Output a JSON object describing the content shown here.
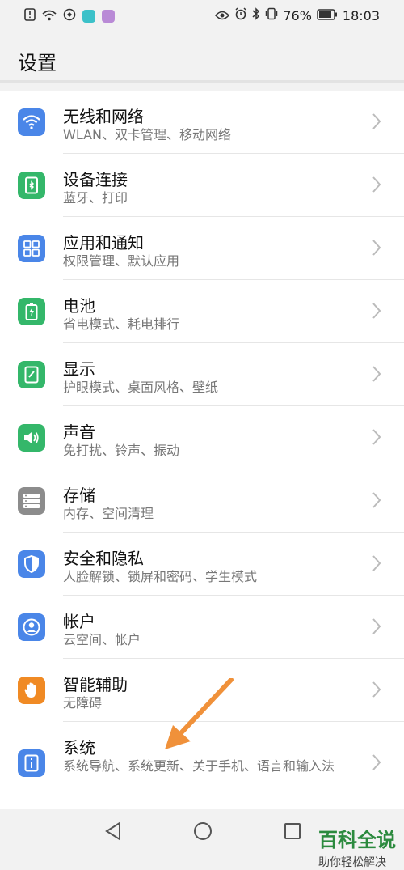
{
  "status": {
    "battery": "76%",
    "time": "18:03"
  },
  "page": {
    "title": "设置"
  },
  "items": [
    {
      "label": "无线和网络",
      "sub": "WLAN、双卡管理、移动网络",
      "icon": "wifi-icon",
      "color": "#4a86e8"
    },
    {
      "label": "设备连接",
      "sub": "蓝牙、打印",
      "icon": "device-connection-icon",
      "color": "#34b76a"
    },
    {
      "label": "应用和通知",
      "sub": "权限管理、默认应用",
      "icon": "apps-grid-icon",
      "color": "#4a86e8"
    },
    {
      "label": "电池",
      "sub": "省电模式、耗电排行",
      "icon": "battery-icon",
      "color": "#34b76a"
    },
    {
      "label": "显示",
      "sub": "护眼模式、桌面风格、壁纸",
      "icon": "display-icon",
      "color": "#34b76a"
    },
    {
      "label": "声音",
      "sub": "免打扰、铃声、振动",
      "icon": "speaker-icon",
      "color": "#34b76a"
    },
    {
      "label": "存储",
      "sub": "内存、空间清理",
      "icon": "storage-icon",
      "color": "#8c8c8c"
    },
    {
      "label": "安全和隐私",
      "sub": "人脸解锁、锁屏和密码、学生模式",
      "icon": "shield-icon",
      "color": "#4a86e8"
    },
    {
      "label": "帐户",
      "sub": "云空间、帐户",
      "icon": "account-icon",
      "color": "#4a86e8"
    },
    {
      "label": "智能辅助",
      "sub": "无障碍",
      "icon": "hand-icon",
      "color": "#f08a24"
    },
    {
      "label": "系统",
      "sub": "系统导航、系统更新、关于手机、语言和输入法",
      "icon": "system-info-icon",
      "color": "#4a86e8"
    }
  ],
  "watermark": {
    "main": "百科全说",
    "sub": "助你轻松解决"
  },
  "colors": {
    "annotation_arrow": "#f0913a"
  }
}
